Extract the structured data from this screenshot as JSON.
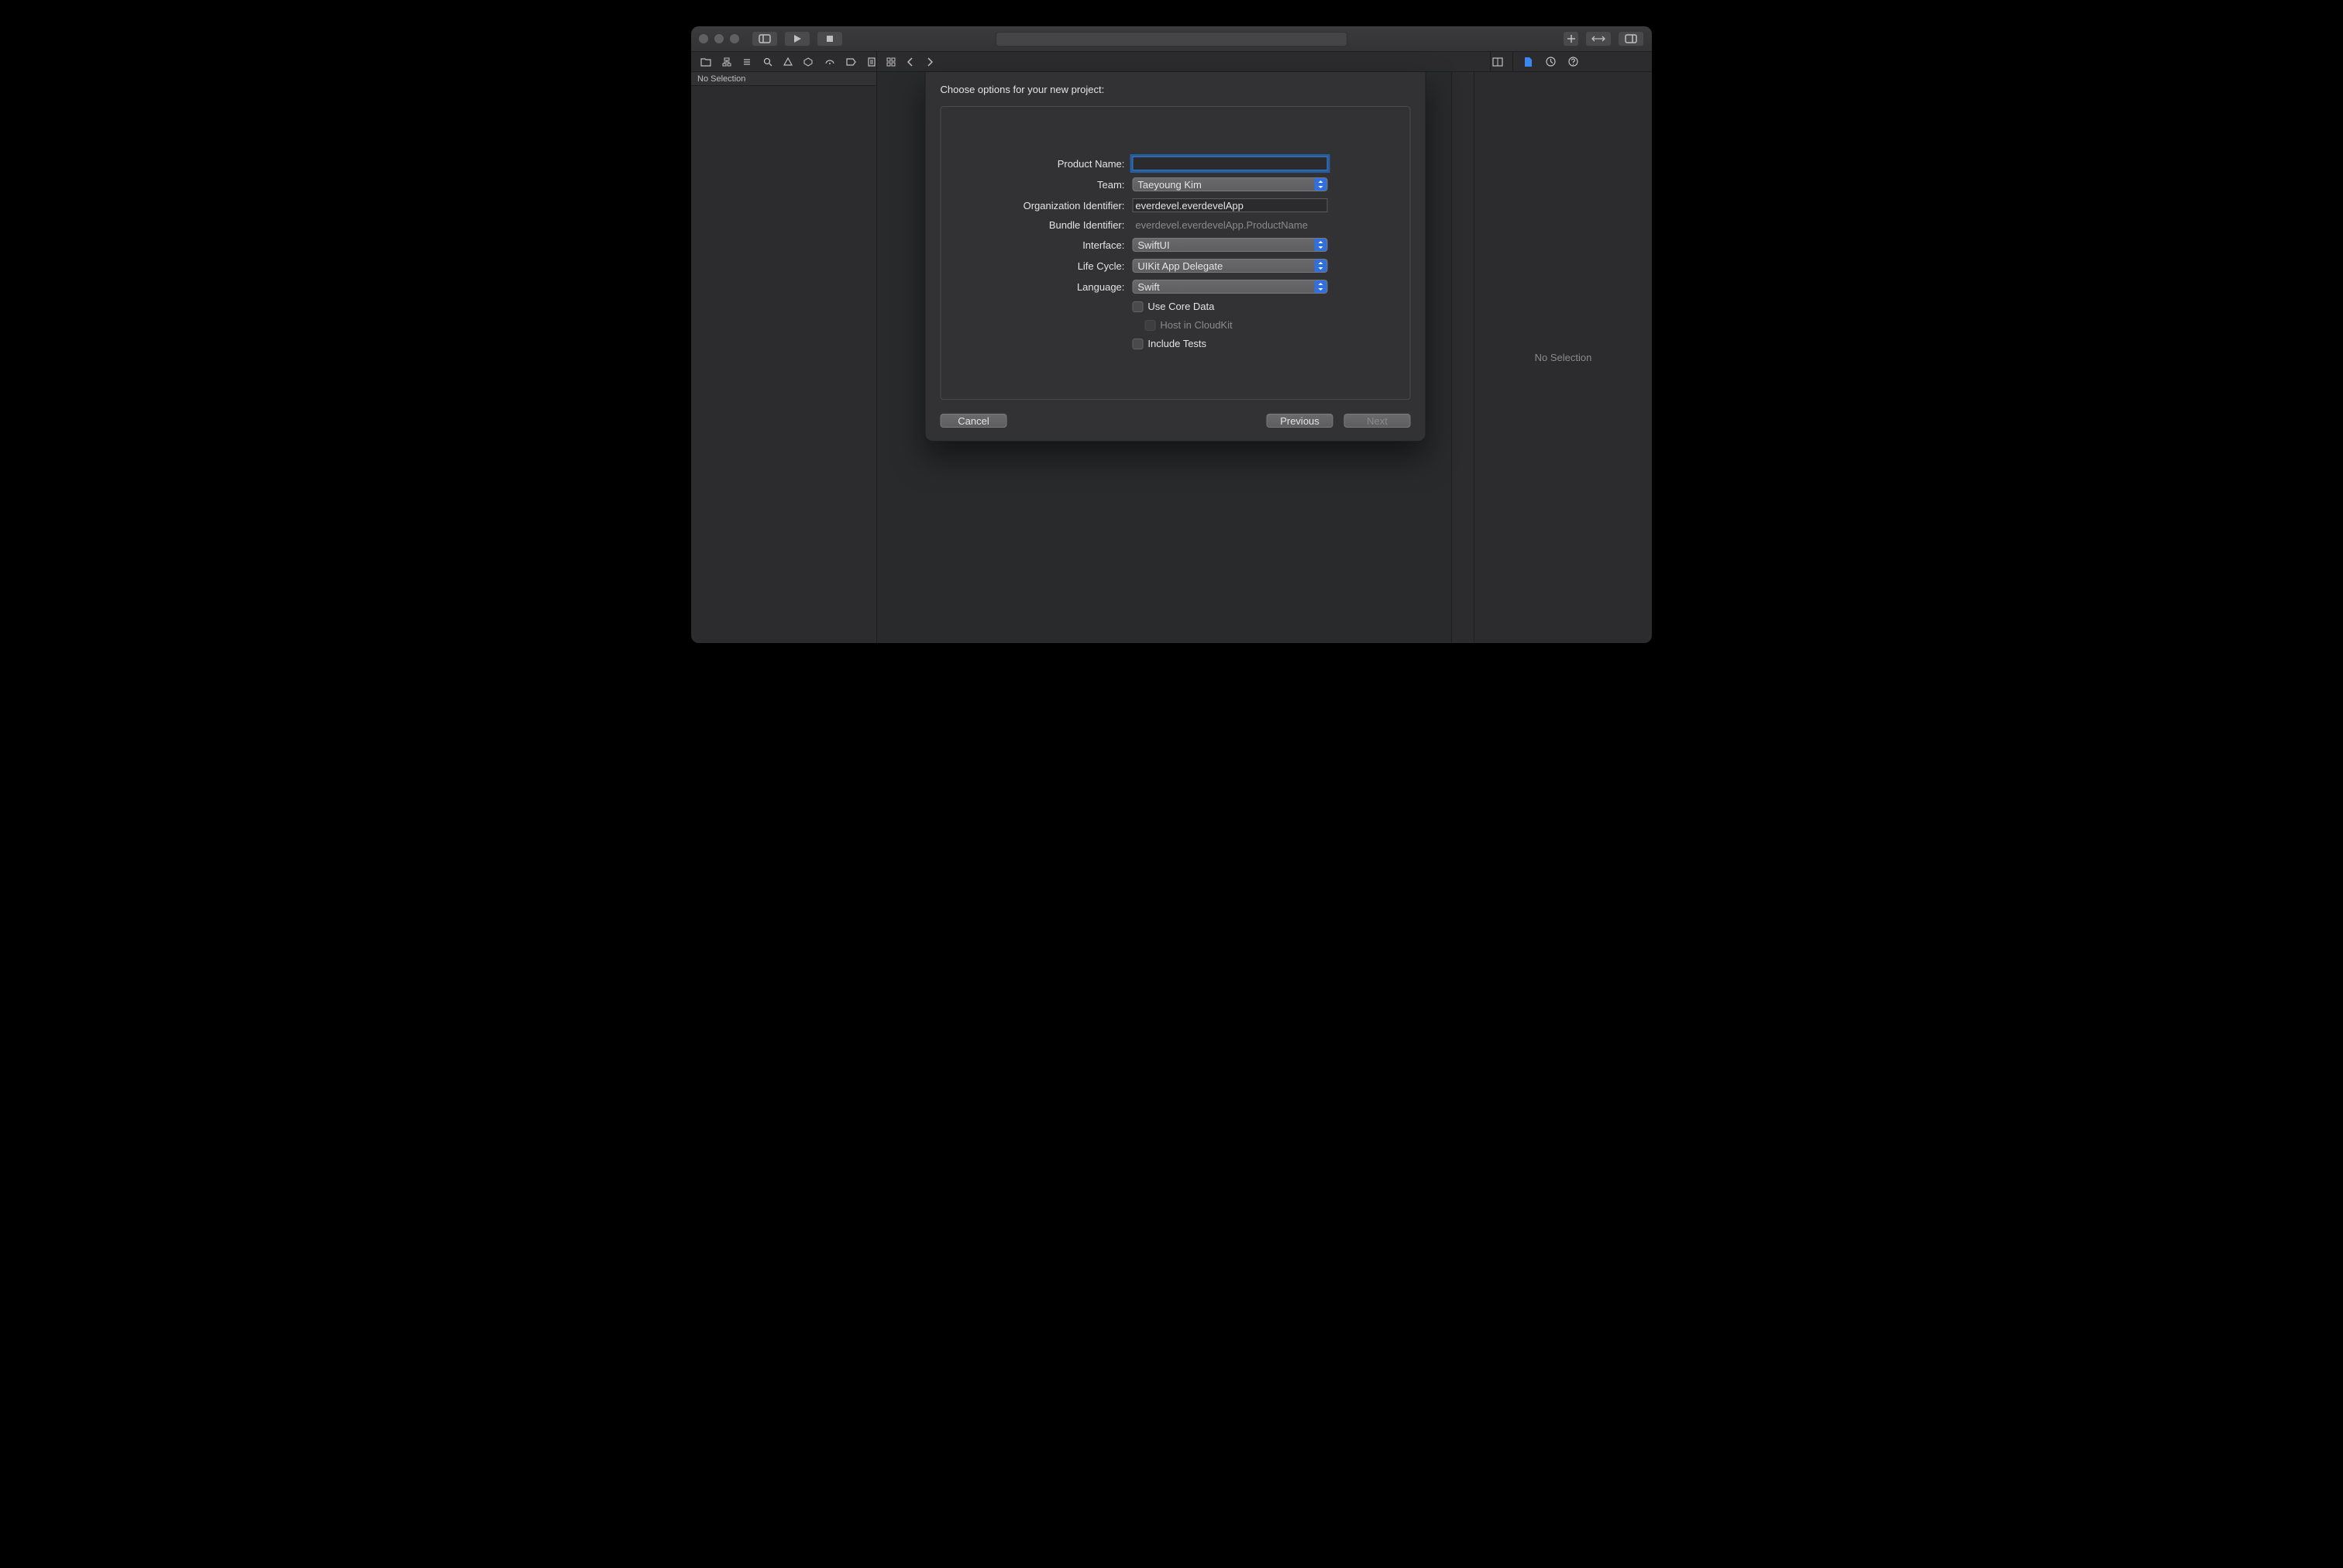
{
  "sidebar_left": {
    "info_text": "No Selection"
  },
  "inspector": {
    "empty_text": "No Selection"
  },
  "sheet": {
    "title": "Choose options for your new project:",
    "labels": {
      "product_name": "Product Name:",
      "team": "Team:",
      "organization_identifier": "Organization Identifier:",
      "bundle_identifier": "Bundle Identifier:",
      "interface": "Interface:",
      "life_cycle": "Life Cycle:",
      "language": "Language:"
    },
    "values": {
      "product_name": "",
      "team": "Taeyoung Kim",
      "organization_identifier": "everdevel.everdevelApp",
      "bundle_identifier": "everdevel.everdevelApp.ProductName",
      "interface": "SwiftUI",
      "life_cycle": "UIKit App Delegate",
      "language": "Swift"
    },
    "checkboxes": {
      "use_core_data": "Use Core Data",
      "host_in_cloudkit": "Host in CloudKit",
      "include_tests": "Include Tests"
    },
    "buttons": {
      "cancel": "Cancel",
      "previous": "Previous",
      "next": "Next"
    }
  }
}
